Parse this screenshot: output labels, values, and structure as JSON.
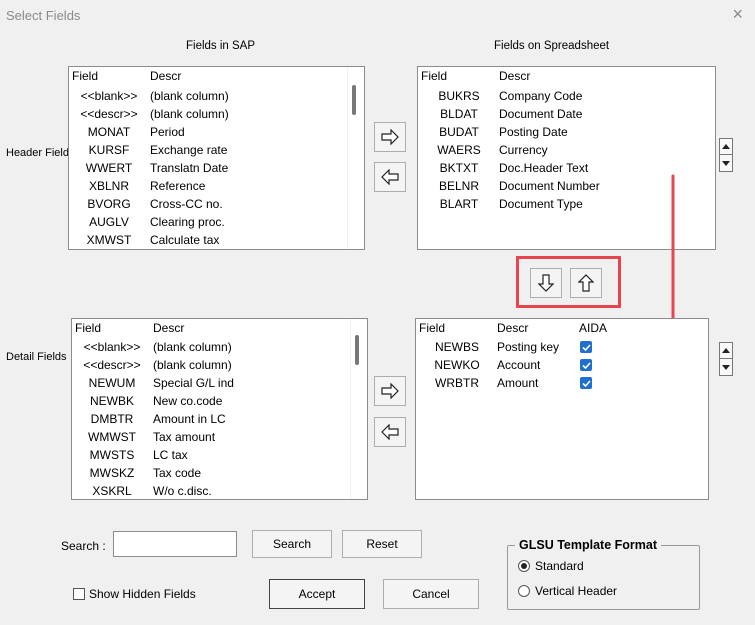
{
  "dialog": {
    "title": "Select Fields",
    "close": "×"
  },
  "headers": {
    "sap": "Fields in SAP",
    "sheet": "Fields on Spreadsheet"
  },
  "side_labels": {
    "header": "Header Fields",
    "detail": "Detail Fields"
  },
  "list_cols": {
    "field": "Field",
    "descr": "Descr",
    "aida": "AIDA"
  },
  "sap_header_rows": [
    {
      "field": "<<blank>>",
      "descr": "(blank column)"
    },
    {
      "field": "<<descr>>",
      "descr": "(blank column)"
    },
    {
      "field": "MONAT",
      "descr": "Period"
    },
    {
      "field": "KURSF",
      "descr": "Exchange rate"
    },
    {
      "field": "WWERT",
      "descr": "Translatn Date"
    },
    {
      "field": "XBLNR",
      "descr": "Reference"
    },
    {
      "field": "BVORG",
      "descr": "Cross-CC no."
    },
    {
      "field": "AUGLV",
      "descr": "Clearing proc."
    },
    {
      "field": "XMWST",
      "descr": "Calculate tax"
    }
  ],
  "sheet_header_rows": [
    {
      "field": "BUKRS",
      "descr": "Company Code"
    },
    {
      "field": "BLDAT",
      "descr": "Document Date"
    },
    {
      "field": "BUDAT",
      "descr": "Posting Date"
    },
    {
      "field": "WAERS",
      "descr": "Currency"
    },
    {
      "field": "BKTXT",
      "descr": "Doc.Header Text"
    },
    {
      "field": "BELNR",
      "descr": "Document Number"
    },
    {
      "field": "BLART",
      "descr": "Document Type"
    }
  ],
  "sap_detail_rows": [
    {
      "field": "<<blank>>",
      "descr": "(blank column)"
    },
    {
      "field": "<<descr>>",
      "descr": "(blank column)"
    },
    {
      "field": "NEWUM",
      "descr": "Special G/L ind"
    },
    {
      "field": "NEWBK",
      "descr": "New co.code"
    },
    {
      "field": "DMBTR",
      "descr": "Amount in LC"
    },
    {
      "field": "WMWST",
      "descr": "Tax amount"
    },
    {
      "field": "MWSTS",
      "descr": "LC tax"
    },
    {
      "field": "MWSKZ",
      "descr": "Tax code"
    },
    {
      "field": "XSKRL",
      "descr": "W/o c.disc."
    }
  ],
  "sheet_detail_rows": [
    {
      "field": "NEWBS",
      "descr": "Posting key",
      "aida": true
    },
    {
      "field": "NEWKO",
      "descr": "Account",
      "aida": true
    },
    {
      "field": "WRBTR",
      "descr": "Amount",
      "aida": true
    }
  ],
  "search": {
    "label": "Search :",
    "value": "",
    "search_button": "Search",
    "reset_button": "Reset"
  },
  "show_hidden": {
    "label": "Show Hidden Fields",
    "checked": false
  },
  "actions": {
    "accept": "Accept",
    "cancel": "Cancel"
  },
  "template_format": {
    "title": "GLSU Template Format",
    "options": [
      "Standard",
      "Vertical Header"
    ],
    "selected": "Standard"
  },
  "colors": {
    "highlight": "#e8454f",
    "checkbox": "#1f6fcf"
  }
}
